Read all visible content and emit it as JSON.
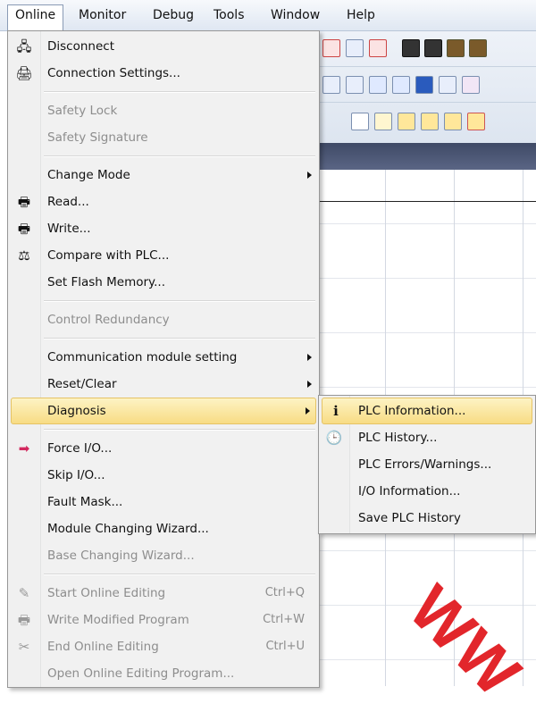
{
  "menubar": {
    "items": [
      "Online",
      "Monitor",
      "Debug",
      "Tools",
      "Window",
      "Help"
    ],
    "active": "Online"
  },
  "online_menu": {
    "items": [
      {
        "label": "Disconnect",
        "icon": "disconnect-icon",
        "enabled": true
      },
      {
        "label": "Connection Settings...",
        "icon": "connection-settings-icon",
        "enabled": true
      },
      {
        "label": "Safety Lock",
        "enabled": false
      },
      {
        "label": "Safety Signature",
        "enabled": false
      },
      {
        "label": "Change Mode",
        "enabled": true,
        "submenu": true
      },
      {
        "label": "Read...",
        "icon": "read-from-plc-icon",
        "enabled": true
      },
      {
        "label": "Write...",
        "icon": "write-to-plc-icon",
        "enabled": true
      },
      {
        "label": "Compare with PLC...",
        "icon": "compare-icon",
        "enabled": true
      },
      {
        "label": "Set Flash Memory...",
        "enabled": true
      },
      {
        "label": "Control Redundancy",
        "enabled": false
      },
      {
        "label": "Communication module setting",
        "enabled": true,
        "submenu": true
      },
      {
        "label": "Reset/Clear",
        "enabled": true,
        "submenu": true
      },
      {
        "label": "Diagnosis",
        "enabled": true,
        "submenu": true,
        "highlighted": true
      },
      {
        "label": "Force I/O...",
        "icon": "force-io-icon",
        "enabled": true
      },
      {
        "label": "Skip I/O...",
        "enabled": true
      },
      {
        "label": "Fault Mask...",
        "enabled": true
      },
      {
        "label": "Module Changing Wizard...",
        "enabled": true
      },
      {
        "label": "Base Changing Wizard...",
        "enabled": false
      },
      {
        "label": "Start Online Editing",
        "icon": "start-online-editing-icon",
        "shortcut": "Ctrl+Q",
        "enabled": false
      },
      {
        "label": "Write Modified Program",
        "icon": "write-modified-program-icon",
        "shortcut": "Ctrl+W",
        "enabled": false
      },
      {
        "label": "End Online Editing",
        "icon": "end-online-editing-icon",
        "shortcut": "Ctrl+U",
        "enabled": false
      },
      {
        "label": "Open Online Editing Program...",
        "enabled": false
      }
    ]
  },
  "diagnosis_submenu": {
    "items": [
      {
        "label": "PLC Information...",
        "icon": "plc-information-icon",
        "highlighted": true
      },
      {
        "label": "PLC History...",
        "icon": "plc-history-icon"
      },
      {
        "label": "PLC Errors/Warnings..."
      },
      {
        "label": "I/O Information..."
      },
      {
        "label": "Save PLC History"
      }
    ]
  },
  "watermark": "WW",
  "colors": {
    "highlight": "#f8dc84",
    "disabled_text": "#8d8d8d",
    "watermark": "#e2262b"
  }
}
